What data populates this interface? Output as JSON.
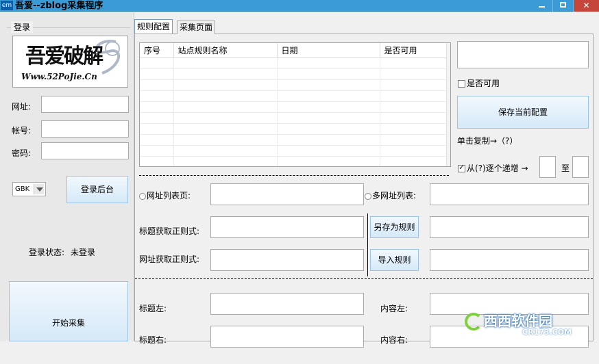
{
  "window": {
    "icon_text": "em",
    "title": "吾爱--zblog采集程序"
  },
  "login": {
    "group_label": "登录",
    "logo_text_main": "吾爱破解",
    "logo_text_url": "Www.52PoJie.Cn",
    "url_label": "网址:",
    "account_label": "帐号:",
    "password_label": "密码:",
    "url_value": "",
    "account_value": "",
    "password_value": "",
    "encoding_value": "GBK",
    "login_button": "登录后台",
    "status_label": "登录状态:",
    "status_value": "未登录",
    "start_button": "开始采集"
  },
  "tabs": [
    {
      "label": "规则配置",
      "active": true
    },
    {
      "label": "采集页面",
      "active": false
    }
  ],
  "grid": {
    "columns": [
      "序号",
      "站点规则名称",
      "日期",
      "是否可用"
    ],
    "rows": []
  },
  "right": {
    "name_value": "",
    "enabled_label": "是否可用",
    "enabled_checked": false,
    "save_button": "保存当前配置",
    "copy_hint": "单击复制→（?）",
    "increment_label": "从(?)逐个递增 →",
    "increment_checked": true,
    "to_label": "至",
    "from_value": "",
    "to_value": ""
  },
  "form": {
    "url_list_label": "网址列表页:",
    "multi_url_label": "多网址列表:",
    "title_regex_label": "标题获取正则式:",
    "url_regex_label": "网址获取正则式:",
    "save_rule_button": "另存为规则",
    "import_rule_button": "导入规则",
    "title_left_label": "标题左:",
    "title_right_label": "标题右:",
    "content_left_label": "内容左:",
    "content_right_label": "内容右:"
  },
  "watermark": {
    "text": "西西软件园",
    "url": "CR173.COM"
  }
}
